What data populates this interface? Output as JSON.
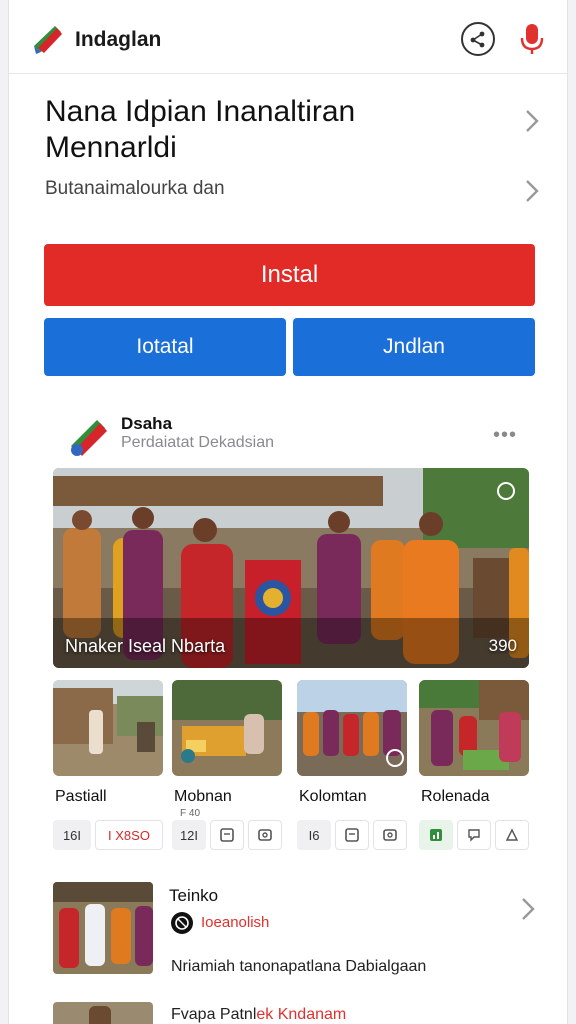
{
  "header": {
    "app_name": "Indaglan",
    "brand_colors": [
      "#d7262b",
      "#2f8f3a",
      "#3467c2"
    ],
    "icons": [
      "share-icon",
      "mic-icon"
    ]
  },
  "main": {
    "title": "Nana Idpian Inanaltiran Mennarldi",
    "subtitle": "Butanaimalourka dan",
    "primary_button": "Instal",
    "secondary_buttons": [
      "Iotatal",
      "Jndlan"
    ],
    "accent_red": "#e22a27",
    "accent_blue": "#1b6fd8"
  },
  "post": {
    "author": "Dsaha",
    "meta": "Perdaiatat Dekadsian",
    "more_label": "•••",
    "hero_caption": "Nnaker Iseal Nbarta",
    "hero_count": "390"
  },
  "cards": [
    {
      "title": "Pastiall",
      "subtitle": "",
      "chips": [
        "16I",
        "I X8SO"
      ]
    },
    {
      "title": "Mobnan",
      "subtitle": "F 40",
      "chips": [
        "12I"
      ],
      "icons": [
        "save-icon",
        "photo-icon"
      ]
    },
    {
      "title": "Kolomtan",
      "subtitle": "",
      "chips": [
        "I6"
      ],
      "icons": [
        "save-icon",
        "photo-icon"
      ]
    },
    {
      "title": "Rolenada",
      "subtitle": "",
      "chips": [],
      "icons": [
        "chart-icon",
        "comment-icon",
        "share-icon"
      ]
    }
  ],
  "list": [
    {
      "title": "Teinko",
      "source": "Ioeanolish",
      "description": "Nriamiah tanonapatlana Dabialgaan"
    },
    {
      "title_prefix": "Fvapa Patnl",
      "title_highlight": "ek Kndanam"
    }
  ]
}
